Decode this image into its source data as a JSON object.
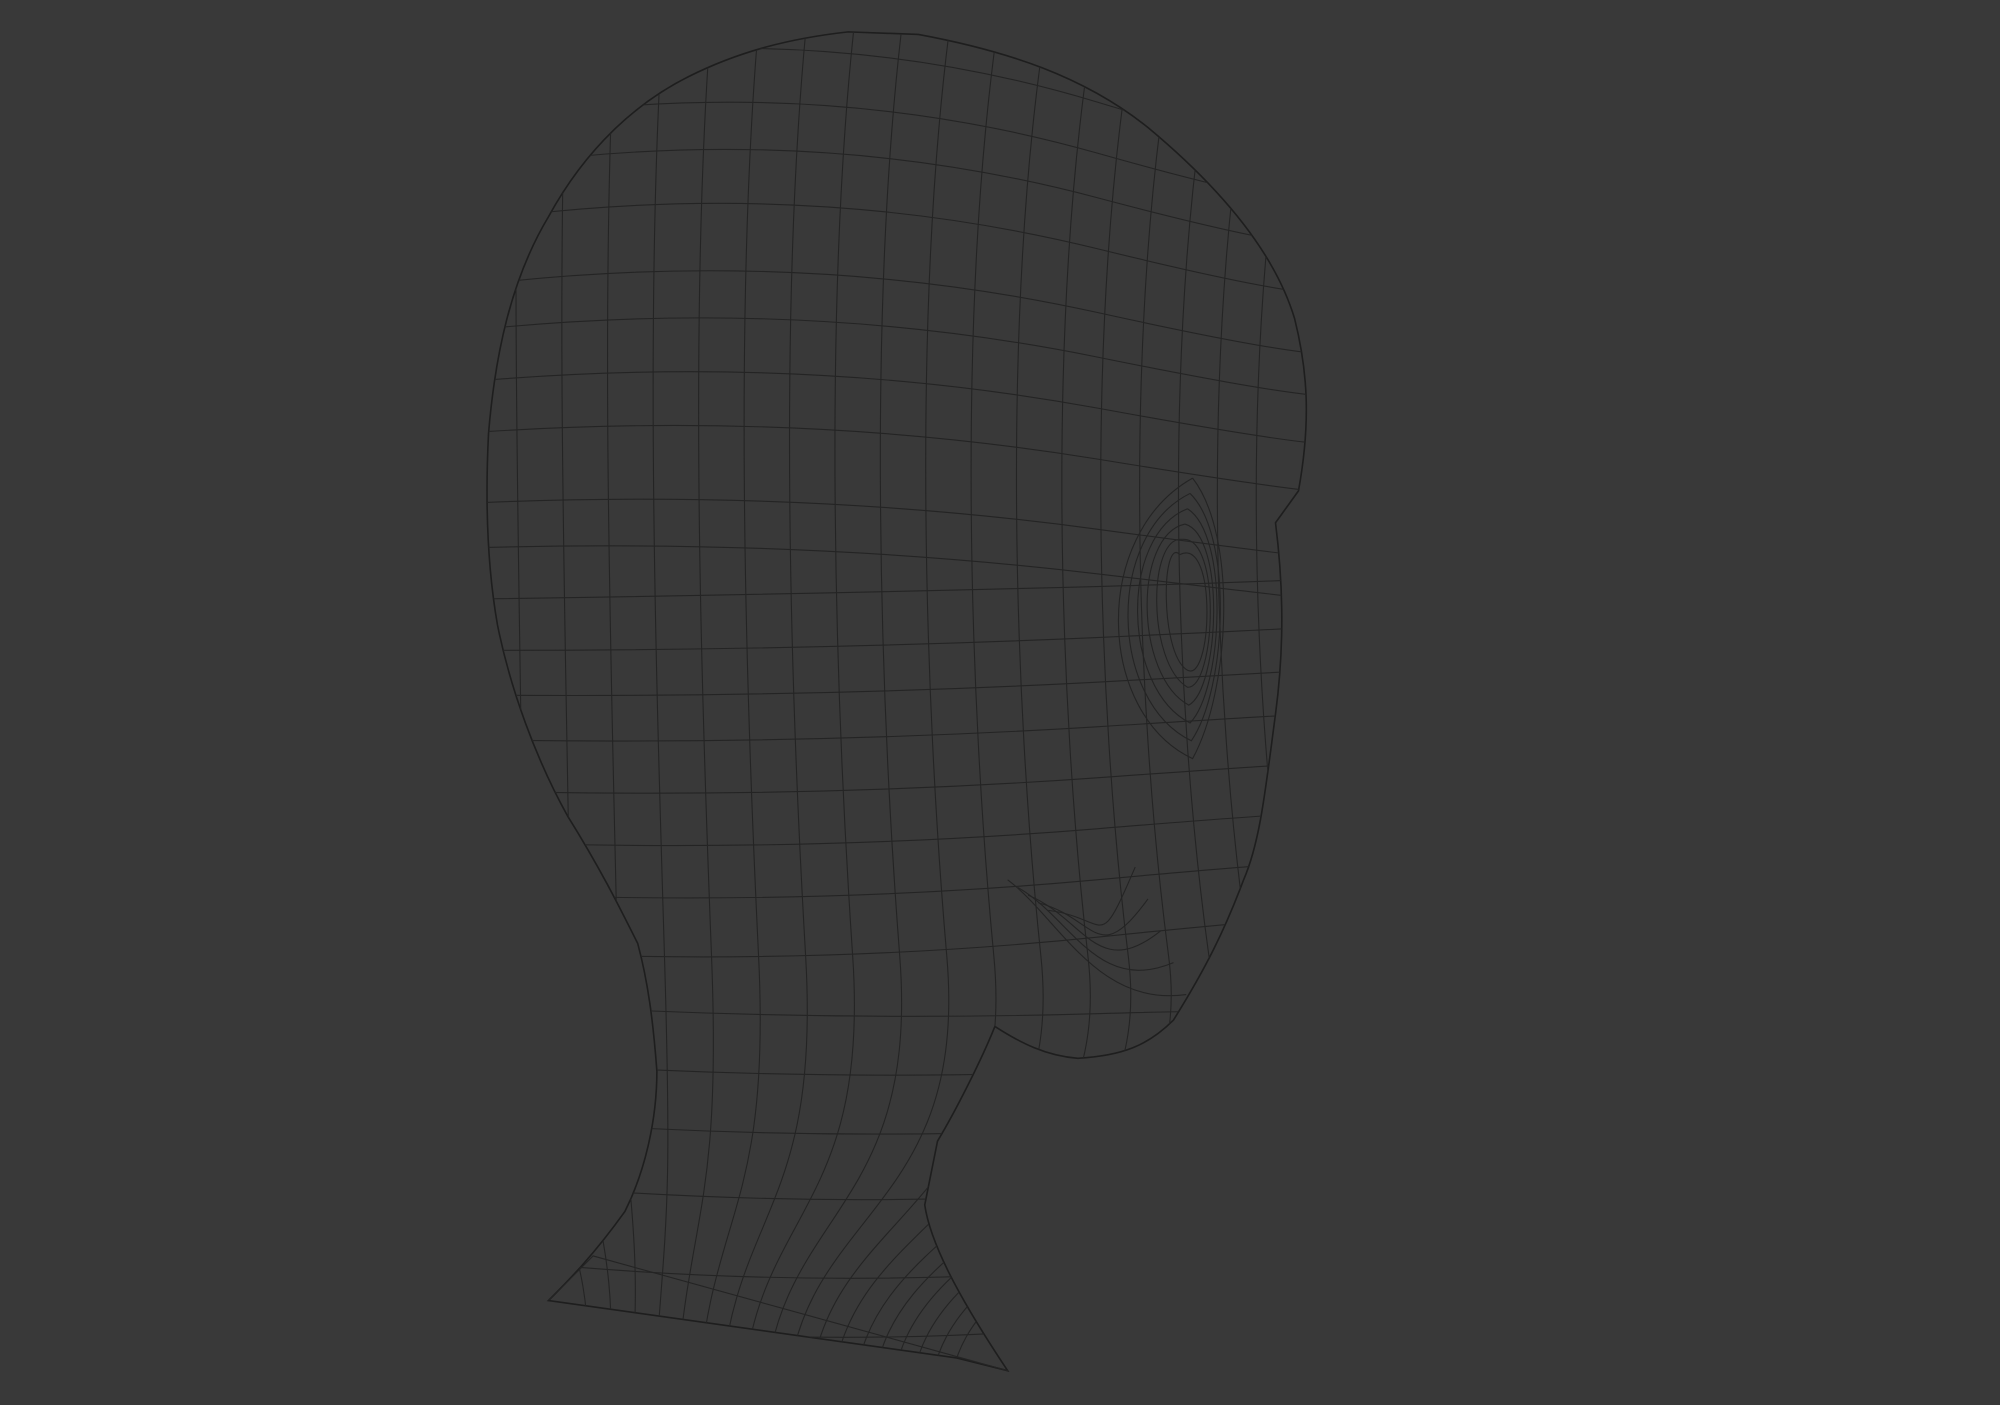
{
  "viewport": {
    "mode": "wireframe",
    "object": "head-mesh",
    "background": "#393939",
    "wire_color": "#242424"
  }
}
